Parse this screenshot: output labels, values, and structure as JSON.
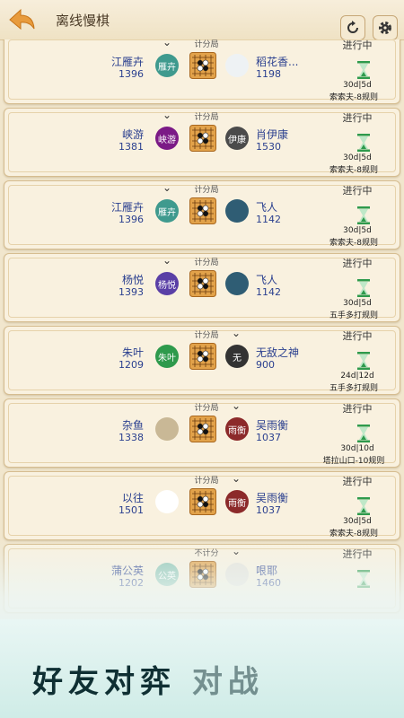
{
  "header": {
    "title": "离线慢棋",
    "back_icon": "back-arrow-icon",
    "refresh_icon": "refresh-icon",
    "settings_icon": "gear-icon"
  },
  "colors": {
    "accent": "#e89b3c",
    "name": "#2a3f8f",
    "hourglass": "#2e9a4c"
  },
  "games": [
    {
      "mode": "计分局",
      "chevron_side": "left",
      "status": "进行中",
      "left": {
        "name": "江雁卉",
        "rating": "1396",
        "avatar": "雁卉",
        "avatar_color": "#3f9a8e"
      },
      "right": {
        "name": "稻花香...",
        "rating": "1198",
        "avatar": "",
        "avatar_color": "#eef2f4"
      },
      "time": "30d|5d",
      "rule": "索索夫-8规则"
    },
    {
      "mode": "计分局",
      "chevron_side": "left",
      "status": "进行中",
      "left": {
        "name": "峡游",
        "rating": "1381",
        "avatar": "峡游",
        "avatar_color": "#7b1a86"
      },
      "right": {
        "name": "肖伊康",
        "rating": "1530",
        "avatar": "伊康",
        "avatar_color": "#4b4b4b"
      },
      "time": "30d|5d",
      "rule": "索索夫-8规则"
    },
    {
      "mode": "计分局",
      "chevron_side": "left",
      "status": "进行中",
      "left": {
        "name": "江雁卉",
        "rating": "1396",
        "avatar": "雁卉",
        "avatar_color": "#3f9a8e"
      },
      "right": {
        "name": "飞人",
        "rating": "1142",
        "avatar": "",
        "avatar_color": "#2f5d74"
      },
      "time": "30d|5d",
      "rule": "索索夫-8规则"
    },
    {
      "mode": "计分局",
      "chevron_side": "left",
      "status": "进行中",
      "left": {
        "name": "杨悦",
        "rating": "1393",
        "avatar": "杨悦",
        "avatar_color": "#5a3fa6"
      },
      "right": {
        "name": "飞人",
        "rating": "1142",
        "avatar": "",
        "avatar_color": "#2f5d74"
      },
      "time": "30d|5d",
      "rule": "五手多打规则"
    },
    {
      "mode": "计分局",
      "chevron_side": "right",
      "status": "进行中",
      "left": {
        "name": "朱叶",
        "rating": "1209",
        "avatar": "朱叶",
        "avatar_color": "#2e9a4c"
      },
      "right": {
        "name": "无敌之神",
        "rating": "900",
        "avatar": "无",
        "avatar_color": "#333333"
      },
      "time": "24d|12d",
      "rule": "五手多打规则"
    },
    {
      "mode": "计分局",
      "chevron_side": "right",
      "status": "进行中",
      "left": {
        "name": "杂鱼",
        "rating": "1338",
        "avatar": "",
        "avatar_color": "#c9b896"
      },
      "right": {
        "name": "吴雨衡",
        "rating": "1037",
        "avatar": "雨衡",
        "avatar_color": "#8c2a2a"
      },
      "time": "30d|10d",
      "rule": "塔拉山口-10规则"
    },
    {
      "mode": "计分局",
      "chevron_side": "right",
      "status": "进行中",
      "left": {
        "name": "以往",
        "rating": "1501",
        "avatar": "",
        "avatar_color": "#ffffff"
      },
      "right": {
        "name": "吴雨衡",
        "rating": "1037",
        "avatar": "雨衡",
        "avatar_color": "#8c2a2a"
      },
      "time": "30d|5d",
      "rule": "索索夫-8规则"
    },
    {
      "mode": "不计分",
      "chevron_side": "right",
      "status": "进行中",
      "left": {
        "name": "蒲公英",
        "rating": "1202",
        "avatar": "公英",
        "avatar_color": "#8cc4b3"
      },
      "right": {
        "name": "哏耶",
        "rating": "1460",
        "avatar": "",
        "avatar_color": "#e6e2da"
      },
      "time": "",
      "rule": ""
    }
  ],
  "banner": {
    "slogan": "好友对弈",
    "slogan_tail": "对战"
  }
}
